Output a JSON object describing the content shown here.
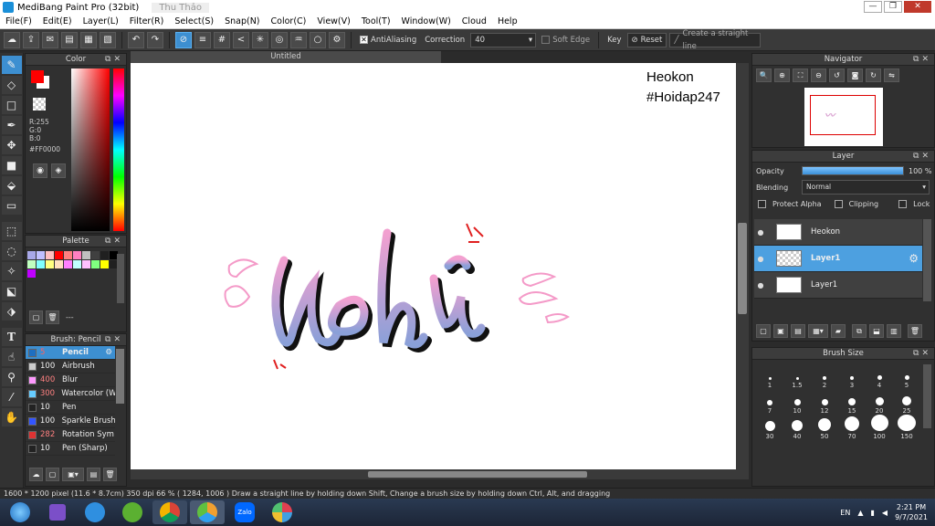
{
  "window": {
    "title": "MediBang Paint Pro (32bit)",
    "subtitle": "Thu Thảo"
  },
  "menu": [
    "File(F)",
    "Edit(E)",
    "Layer(L)",
    "Filter(R)",
    "Select(S)",
    "Snap(N)",
    "Color(C)",
    "View(V)",
    "Tool(T)",
    "Window(W)",
    "Cloud",
    "Help"
  ],
  "toolbar": {
    "antialiasing_label": "AntiAliasing",
    "correction_label": "Correction",
    "correction_value": "40",
    "soft_edge_label": "Soft Edge",
    "key_label": "Key",
    "reset_label": "Reset",
    "straight_line_label": "Create a straight line"
  },
  "color_panel": {
    "title": "Color",
    "r": "R:255",
    "g": "G:0",
    "b": "B:0",
    "hex": "#FF0000",
    "fg": "#ff0000",
    "bg": "#ffffff"
  },
  "palette": {
    "title": "Palette",
    "dashes": "---",
    "colors": [
      "#a8a8e8",
      "#c0c0ff",
      "#ffc0c0",
      "#ff0000",
      "#ff8080",
      "#ff80c0",
      "#c0c0c0",
      "#404040",
      "#202020",
      "#000000",
      "#c0ffc0",
      "#80ffff",
      "#ffff80",
      "#ffe0c0",
      "#ff80ff",
      "#c0ffff",
      "#ffc0ff",
      "#80ff80",
      "#ffff00",
      "#202020",
      "#c000ff"
    ]
  },
  "brush": {
    "title": "Brush: Pencil",
    "items": [
      {
        "size": "5",
        "name": "Pencil",
        "color": "#ff0000",
        "selected": true
      },
      {
        "size": "100",
        "name": "Airbrush",
        "color": "#cccccc"
      },
      {
        "size": "400",
        "name": "Blur",
        "color": "#ff99ff"
      },
      {
        "size": "300",
        "name": "Watercolor (W",
        "color": "#66ccff"
      },
      {
        "size": "10",
        "name": "Pen",
        "color": "#222222"
      },
      {
        "size": "100",
        "name": "Sparkle Brush",
        "color": "#3355ff"
      },
      {
        "size": "282",
        "name": "Rotation Sym",
        "color": "#dd3333"
      },
      {
        "size": "10",
        "name": "Pen (Sharp)",
        "color": "#222222"
      }
    ]
  },
  "canvas": {
    "tab": "Untitled",
    "text_line1": "Heokon",
    "text_line2": "#Hoidap247"
  },
  "navigator": {
    "title": "Navigator"
  },
  "layer_panel": {
    "title": "Layer",
    "opacity_label": "Opacity",
    "opacity_value": "100 %",
    "opacity_fraction": 1.0,
    "blending_label": "Blending",
    "blending_value": "Normal",
    "protect_alpha": "Protect Alpha",
    "clipping": "Clipping",
    "lock": "Lock",
    "layers": [
      {
        "name": "Heokon",
        "selected": false
      },
      {
        "name": "Layer1",
        "selected": true
      },
      {
        "name": "Layer1",
        "selected": false
      }
    ]
  },
  "brush_size": {
    "title": "Brush Size",
    "sizes": [
      "1",
      "1.5",
      "2",
      "3",
      "4",
      "5",
      "7",
      "10",
      "12",
      "15",
      "20",
      "25",
      "30",
      "40",
      "50",
      "70",
      "100",
      "150"
    ]
  },
  "status": {
    "text": "1600 * 1200 pixel   (11.6 * 8.7cm)   350 dpi   66 %   ( 1284, 1006 )   Draw a straight line by holding down Shift, Change a brush size by holding down Ctrl, Alt, and dragging"
  },
  "taskbar": {
    "lang": "EN",
    "time": "2:21 PM",
    "date": "9/7/2021",
    "zalo": "Zalo"
  }
}
